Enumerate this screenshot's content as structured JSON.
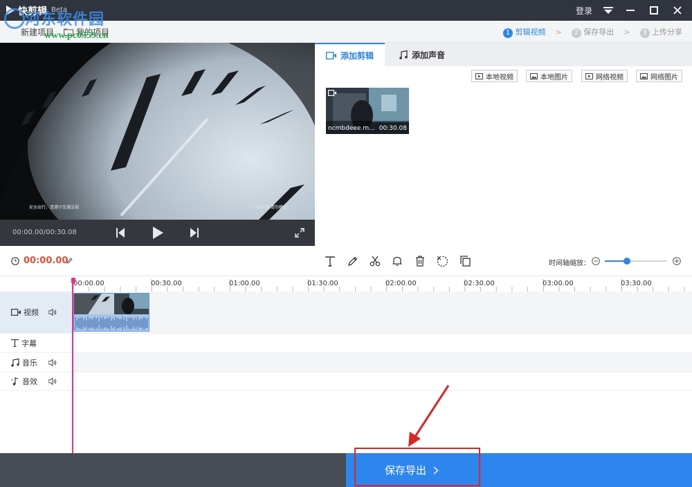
{
  "titlebar": {
    "app_name": "快剪辑",
    "beta": "Beta",
    "login": "登录"
  },
  "toolbar": {
    "new_project": "新建项目",
    "my_projects": "我的项目",
    "steps": [
      {
        "num": "1",
        "label": "剪辑视频"
      },
      {
        "num": "2",
        "label": "保存导出"
      },
      {
        "num": "3",
        "label": "上传分享"
      }
    ]
  },
  "watermark": {
    "name": "河东软件园",
    "url": "www.pc0359.cn"
  },
  "preview": {
    "caption_left": "安全出行，请遵守交通法规",
    "caption_right": "广告标语 请勿模仿",
    "time": "00:00.00/00:30.08"
  },
  "media": {
    "tabs": [
      "添加剪辑",
      "添加声音"
    ],
    "sources": [
      "本地视频",
      "本地图片",
      "网络视频",
      "网络图片"
    ],
    "clip": {
      "name": "ncmbdeee.m...",
      "duration": "00:30.08"
    }
  },
  "edit_bar": {
    "current_time": "00:00.00",
    "zoom_label": "时间轴缩放：",
    "zoom_level": 0.35
  },
  "ruler": [
    "00:00.00",
    "00:30.00",
    "01:00.00",
    "01:30.00",
    "02:00.00",
    "02:30.00",
    "03:00.00",
    "03:30.00"
  ],
  "tracks": [
    {
      "label": "视频"
    },
    {
      "label": "字幕"
    },
    {
      "label": "音乐"
    },
    {
      "label": "音效"
    }
  ],
  "export_button": "保存导出",
  "colors": {
    "accent": "#2c86ee",
    "title_bar": "#2f343f",
    "time_red": "#e8502f",
    "highlight": "#e02424"
  }
}
